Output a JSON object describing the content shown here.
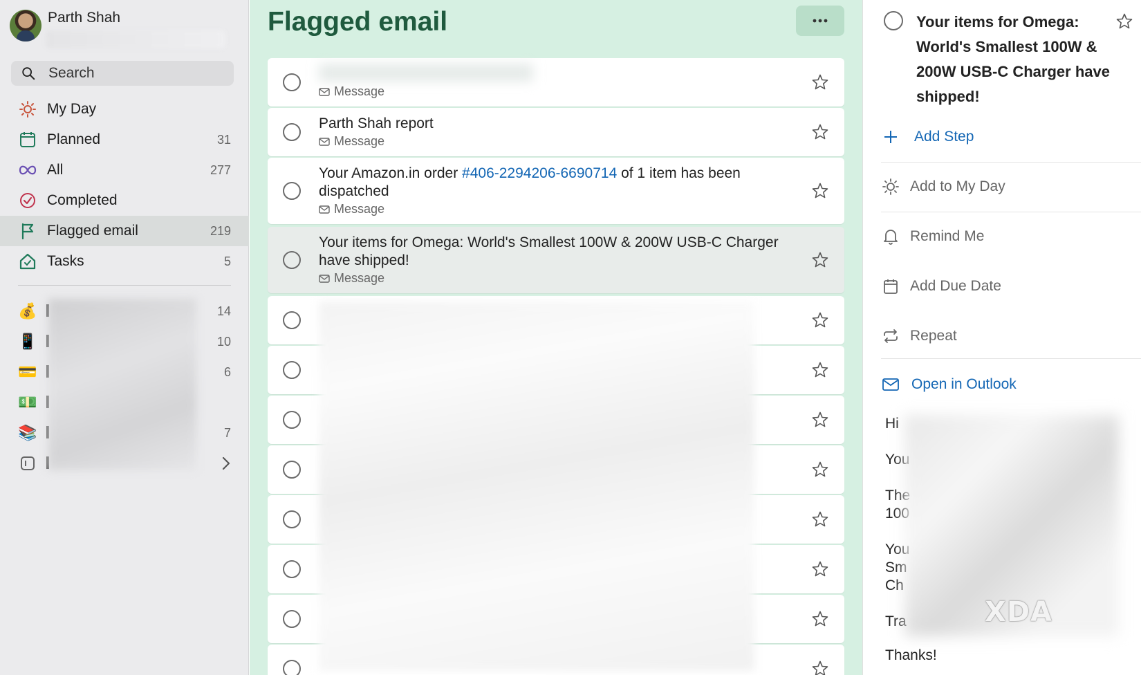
{
  "user": {
    "name": "Parth Shah"
  },
  "search": {
    "label": "Search"
  },
  "nav": [
    {
      "label": "My Day",
      "count": "",
      "icon": "sun-icon"
    },
    {
      "label": "Planned",
      "count": "31",
      "icon": "calendar-icon"
    },
    {
      "label": "All",
      "count": "277",
      "icon": "infinity-icon"
    },
    {
      "label": "Completed",
      "count": "",
      "icon": "check-circle-icon"
    },
    {
      "label": "Flagged email",
      "count": "219",
      "icon": "flag-icon"
    },
    {
      "label": "Tasks",
      "count": "5",
      "icon": "home-icon"
    }
  ],
  "lists": [
    {
      "icon": "money-bag-icon",
      "count": "14"
    },
    {
      "icon": "phone-icon",
      "count": "10"
    },
    {
      "icon": "credit-card-icon",
      "count": "6"
    },
    {
      "icon": "banknote-icon",
      "count": ""
    },
    {
      "icon": "books-icon",
      "count": "7"
    },
    {
      "icon": "group-icon",
      "count": ""
    }
  ],
  "main": {
    "title": "Flagged email",
    "tasks": [
      {
        "title": "",
        "sub": "Message"
      },
      {
        "title": "Parth Shah report",
        "sub": "Message"
      },
      {
        "title_pre": "Your Amazon.in order ",
        "title_link": "#406-2294206-6690714",
        "title_post": " of 1 item has been dispatched",
        "sub": "Message"
      },
      {
        "title": "Your items for Omega: World's Smallest 100W & 200W USB-C Charger have shipped!",
        "sub": "Message"
      }
    ]
  },
  "detail": {
    "title": "Your items for Omega: World's Smallest 100W & 200W USB-C Charger have shipped!",
    "add_step": "Add Step",
    "add_to_my_day": "Add to My Day",
    "remind_me": "Remind Me",
    "add_due_date": "Add Due Date",
    "repeat": "Repeat",
    "open_in_outlook": "Open in Outlook",
    "body": [
      "Hi",
      "You",
      "The",
      "100",
      "You",
      "Sm",
      "Ch",
      "Tra",
      "Thanks!"
    ],
    "watermark": "XDA"
  },
  "colors": {
    "accent": "#1366b4",
    "list_title": "#1f5a3e",
    "middle_bg": "#d6f0e2"
  }
}
